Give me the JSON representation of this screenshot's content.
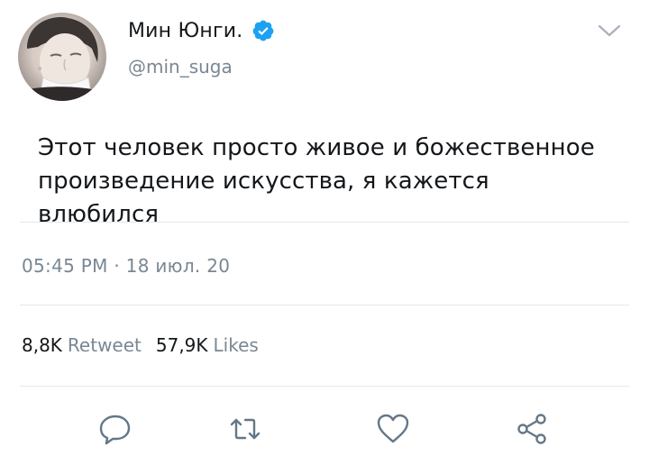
{
  "author": {
    "display_name": "Мин Юнги.",
    "handle": "@min_suga"
  },
  "tweet": {
    "text_line_1": "Этот человек просто живое и божественное",
    "text_line_2": "произведение искусства, я кажется влюбился",
    "timestamp": "05:45 PM · 18 июл. 20"
  },
  "stats": {
    "retweets_count": "8,8K",
    "retweets_label": "Retweet",
    "likes_count": "57,9K",
    "likes_label": "Likes"
  },
  "icons": {
    "verified": "verified-badge-icon",
    "menu": "chevron-down-icon",
    "reply": "reply-icon",
    "retweet": "retweet-icon",
    "like": "heart-icon",
    "share": "share-icon"
  },
  "colors": {
    "verified_blue": "#1da1f2",
    "secondary_text": "#7a8793",
    "icon_gray": "#657786",
    "divider": "#e1e8ed"
  }
}
